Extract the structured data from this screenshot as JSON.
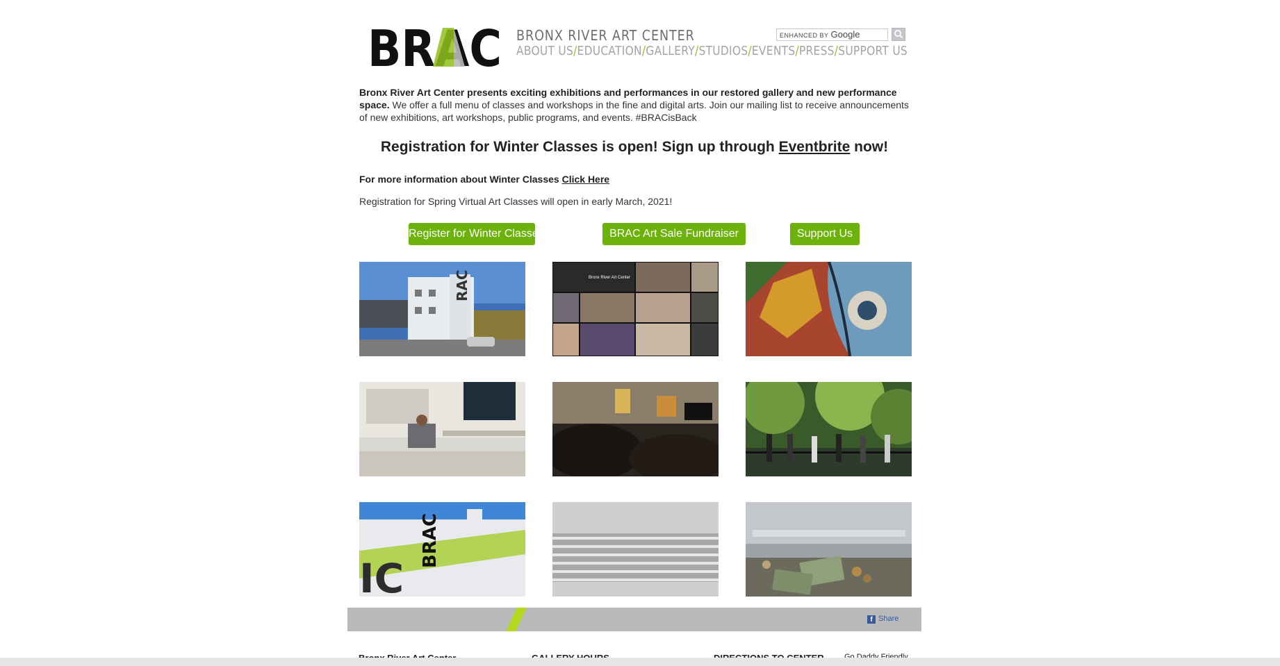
{
  "header": {
    "logo_text": "BRAC",
    "site_title": "BRONX RIVER ART CENTER",
    "nav": [
      "ABOUT US",
      "EDUCATION",
      "GALLERY",
      "STUDIOS",
      "EVENTS",
      "PRESS",
      "SUPPORT US"
    ],
    "search": {
      "prefix": "ENHANCED BY",
      "brand": "Google"
    }
  },
  "intro": {
    "bold": "Bronx River Art Center presents exciting exhibitions and performances in our restored gallery and new performance space.",
    "rest": " We offer a full menu of classes and workshops in the fine and digital arts. Join our mailing list to receive announcements of new exhibitions, art workshops, public programs, and events. #BRACisBack"
  },
  "headline": {
    "before": "Registration for Winter Classes is open! Sign up through ",
    "link": "Eventbrite",
    "after": " now!"
  },
  "more_info": {
    "text": "For more information about Winter Classes ",
    "link": "Click Here"
  },
  "spring_note": "Registration for Spring Virtual Art Classes will open in early March, 2021!",
  "buttons": {
    "winter": "Register for Winter Classes",
    "fundraiser": "BRAC Art Sale Fundraiser",
    "support": "Support Us"
  },
  "footer": {
    "share": "Share",
    "col1": "Bronx River Art Center",
    "col2": "GALLERY HOURS",
    "col3": "DIRECTIONS TO CENTER",
    "col3b": "Go Daddy Friendly"
  },
  "colors": {
    "accent_green": "#6cb20a",
    "nav_separator": "#93c01f",
    "footer_bar": "#b9babc"
  }
}
